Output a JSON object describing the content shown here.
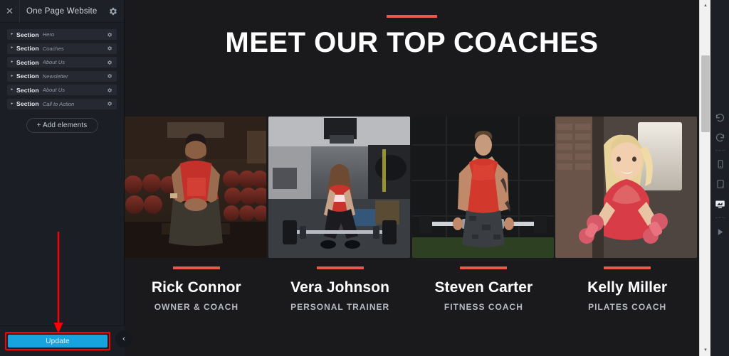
{
  "left_panel": {
    "close_icon": "close-icon",
    "title": "One Page Website",
    "settings_icon": "gear-icon",
    "sections": [
      {
        "caret": "▸",
        "word": "Section",
        "label": "Hero",
        "gear": "gear-icon"
      },
      {
        "caret": "▸",
        "word": "Section",
        "label": "Coaches",
        "gear": "gear-icon"
      },
      {
        "caret": "▸",
        "word": "Section",
        "label": "About Us",
        "gear": "gear-icon"
      },
      {
        "caret": "▸",
        "word": "Section",
        "label": "Newsletter",
        "gear": "gear-icon"
      },
      {
        "caret": "▸",
        "word": "Section",
        "label": "About Us",
        "gear": "gear-icon"
      },
      {
        "caret": "▸",
        "word": "Section",
        "label": "Call to Action",
        "gear": "gear-icon"
      }
    ],
    "add_elements_label": "+ Add elements",
    "update_label": "Update",
    "collapse_icon": "‹"
  },
  "canvas": {
    "heading": "MEET OUR TOP COACHES",
    "accent_color": "#e8594a",
    "background_color": "#1a1a1c",
    "coaches": [
      {
        "name": "Rick Connor",
        "role": "OWNER & COACH",
        "photo": "coach-photo-gym-dumbbells"
      },
      {
        "name": "Vera Johnson",
        "role": "PERSONAL TRAINER",
        "photo": "coach-photo-deadlift"
      },
      {
        "name": "Steven Carter",
        "role": "FITNESS COACH",
        "photo": "coach-photo-barbell-curl"
      },
      {
        "name": "Kelly Miller",
        "role": "PILATES COACH",
        "photo": "coach-photo-dumbbells-brick"
      }
    ]
  },
  "right_toolbar": {
    "tools": [
      {
        "name": "undo-icon",
        "active": false
      },
      {
        "name": "redo-icon",
        "active": false
      },
      {
        "name": "mobile-view-icon",
        "active": false
      },
      {
        "name": "tablet-view-icon",
        "active": false
      },
      {
        "name": "desktop-view-icon",
        "active": true
      },
      {
        "name": "preview-play-icon",
        "active": false
      }
    ]
  },
  "annotation": {
    "arrow_color": "#ff0000",
    "highlight_color": "#ff0000",
    "target": "update-button"
  },
  "colors": {
    "update_button": "#17a3dd",
    "panel_bg": "#1c1e25",
    "row_bg": "#262932"
  }
}
